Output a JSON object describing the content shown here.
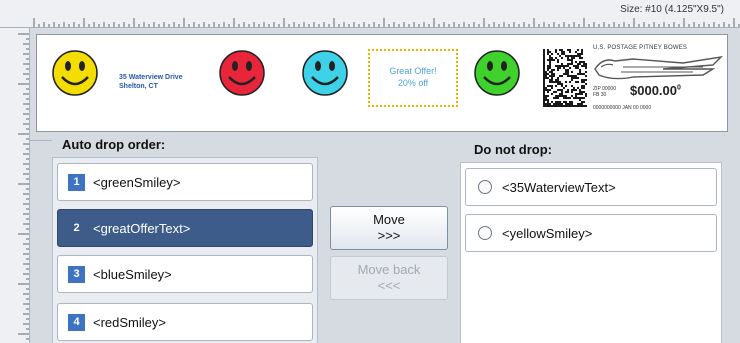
{
  "ruler": {
    "size_label": "Size: #10 (4.125\"X9.5\")"
  },
  "envelope": {
    "address_line1": "35 Waterview Drive",
    "address_line2": "Shelton, CT",
    "offer_line1": "Great Offer!",
    "offer_line2": "20% off",
    "smileys": [
      {
        "name": "yellow",
        "color": "#f4dd00"
      },
      {
        "name": "red",
        "color": "#e8253a"
      },
      {
        "name": "blue",
        "color": "#3ed2e8"
      },
      {
        "name": "green",
        "color": "#3fd22c"
      }
    ],
    "postage": {
      "header": "U.S. POSTAGE PITNEY BOWES",
      "zip": "ZIP 00000",
      "zip2": "FB 30",
      "amount": "$000.00",
      "amount_super": "0",
      "serial": "0000000000  JAN 00 0000"
    }
  },
  "left_panel": {
    "title": "Auto drop order:",
    "items": [
      {
        "number": "1",
        "label": "<greenSmiley>"
      },
      {
        "number": "2",
        "label": "<greatOfferText>",
        "selected": true
      },
      {
        "number": "3",
        "label": "<blueSmiley>"
      },
      {
        "number": "4",
        "label": "<redSmiley>"
      }
    ]
  },
  "buttons": {
    "move_line1": "Move",
    "move_line2": ">>>",
    "back_line1": "Move back",
    "back_line2": "<<<"
  },
  "right_panel": {
    "title": "Do not drop:",
    "items": [
      {
        "label": "<35WaterviewText>"
      },
      {
        "label": "<yellowSmiley>"
      }
    ]
  }
}
